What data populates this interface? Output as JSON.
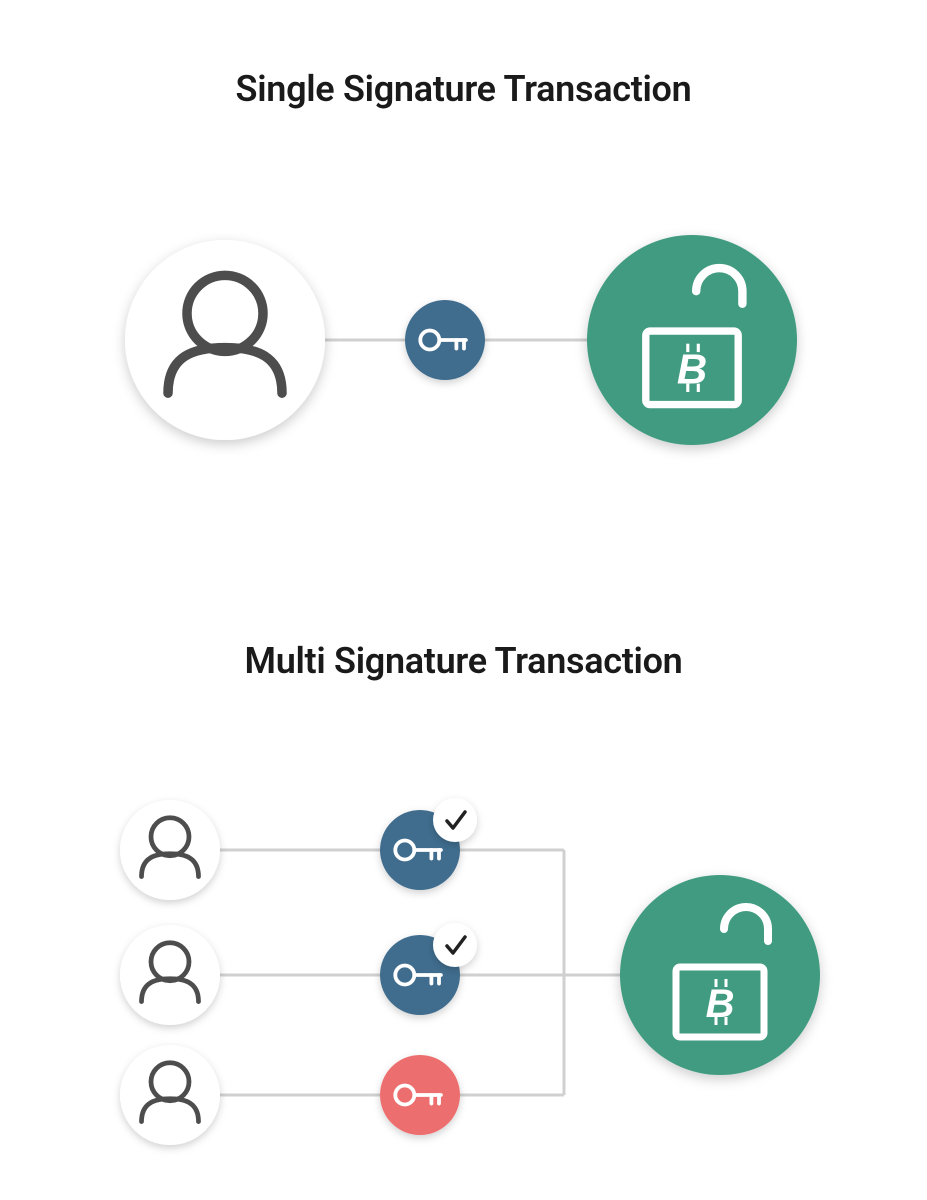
{
  "diagram": {
    "single": {
      "title": "Single Signature Transaction",
      "key_colors": [
        "#3F6D8E"
      ],
      "lock_color": "#3F9B80",
      "user_count": 1
    },
    "multi": {
      "title": "Multi Signature Transaction",
      "signers": [
        {
          "key_color": "#3F6D8E",
          "approved": true
        },
        {
          "key_color": "#3F6D8E",
          "approved": true
        },
        {
          "key_color": "#ED6E6E",
          "approved": false
        }
      ],
      "lock_color": "#3F9B80"
    }
  },
  "colors": {
    "line": "#D0D0D0",
    "user_stroke": "#4D4D4D",
    "check_stroke": "#222222",
    "shadow": "rgba(0,0,0,0.18)"
  }
}
